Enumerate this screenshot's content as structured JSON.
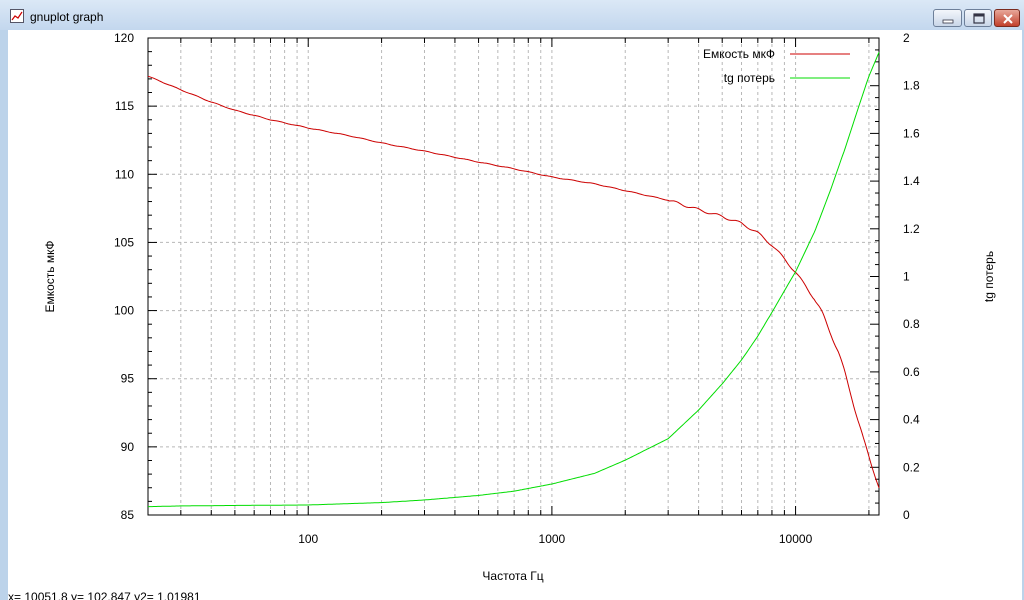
{
  "window": {
    "title": "gnuplot graph",
    "icon": "gnuplot-app-icon",
    "controls": [
      "minimize-icon",
      "maximize-icon",
      "close-icon"
    ]
  },
  "status_text": "x= 10051.8 y= 102.847 y2= 1.01981",
  "chart_data": {
    "type": "line",
    "title": "",
    "xlabel": "Частота Гц",
    "ylabel": "Емкость мкФ",
    "y2label": "tg потерь",
    "x_scale": "log",
    "xlim": [
      22,
      22000
    ],
    "ylim": [
      85,
      120
    ],
    "y2lim": [
      0,
      2
    ],
    "x_ticks": [
      100,
      1000,
      10000
    ],
    "x_tick_labels": [
      "100",
      "1000",
      "10000"
    ],
    "y_ticks": [
      85,
      90,
      95,
      100,
      105,
      110,
      115,
      120
    ],
    "y2_ticks": [
      0,
      0.2,
      0.4,
      0.6,
      0.8,
      1,
      1.2,
      1.4,
      1.6,
      1.8,
      2
    ],
    "y2_tick_labels": [
      "0",
      "0.2",
      "0.4",
      "0.6",
      "0.8",
      "1",
      "1.2",
      "1.4",
      "1.6",
      "1.8",
      "2"
    ],
    "grid": true,
    "legend_position": "top-right",
    "series": [
      {
        "name": "Емкость мкФ",
        "axis": "y",
        "color": "#cc0000",
        "x": [
          22,
          30,
          40,
          50,
          70,
          100,
          150,
          200,
          300,
          500,
          700,
          1000,
          1500,
          2000,
          3000,
          4000,
          5000,
          6000,
          7000,
          8000,
          9000,
          10000,
          11000,
          12000,
          13000,
          14000,
          15000,
          16000,
          17000,
          18000,
          19000,
          20000,
          21000,
          22000
        ],
        "y": [
          117.2,
          116.2,
          115.3,
          114.7,
          114.0,
          113.4,
          112.8,
          112.3,
          111.7,
          110.9,
          110.4,
          109.8,
          109.3,
          108.8,
          108.1,
          107.4,
          106.9,
          106.4,
          105.7,
          104.8,
          103.8,
          102.8,
          101.8,
          100.8,
          99.6,
          98.3,
          96.9,
          95.3,
          93.7,
          92.0,
          90.5,
          89.3,
          88.2,
          87.0
        ]
      },
      {
        "name": "tg потерь",
        "axis": "y2",
        "color": "#00dd00",
        "x": [
          22,
          30,
          50,
          100,
          150,
          200,
          300,
          500,
          700,
          1000,
          1500,
          2000,
          3000,
          4000,
          5000,
          6000,
          7000,
          8000,
          9000,
          10000,
          12000,
          14000,
          16000,
          18000,
          20000,
          22000
        ],
        "y": [
          0.035,
          0.038,
          0.04,
          0.042,
          0.048,
          0.052,
          0.063,
          0.082,
          0.1,
          0.13,
          0.175,
          0.23,
          0.32,
          0.44,
          0.55,
          0.65,
          0.75,
          0.85,
          0.94,
          1.02,
          1.19,
          1.37,
          1.54,
          1.7,
          1.84,
          1.94
        ]
      }
    ]
  }
}
